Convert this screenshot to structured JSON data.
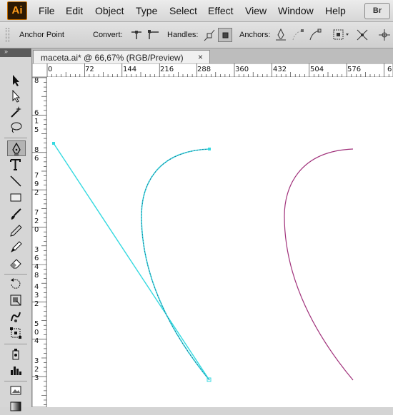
{
  "app": {
    "logo": "Ai",
    "menus": [
      "File",
      "Edit",
      "Object",
      "Type",
      "Select",
      "Effect",
      "View",
      "Window",
      "Help"
    ],
    "bridge_button": "Br"
  },
  "control_bar": {
    "tool_name": "Anchor Point",
    "convert_label": "Convert:",
    "handles_label": "Handles:",
    "anchors_label": "Anchors:"
  },
  "document": {
    "tab_title": "maceta.ai* @ 66,67% (RGB/Preview)",
    "close_glyph": "×",
    "zoom": "66,67%",
    "color_mode": "RGB/Preview"
  },
  "rulers": {
    "horizontal": [
      "0",
      "72",
      "144",
      "216",
      "288",
      "360",
      "432",
      "504",
      "576",
      "6"
    ],
    "vertical": [
      "8",
      "6",
      "1",
      "5",
      "8",
      "6",
      "7",
      "9",
      "2",
      "7",
      "2",
      "0",
      "3",
      "6",
      "4",
      "8",
      "4",
      "3",
      "2",
      "5",
      "0",
      "4",
      "3",
      "2",
      "3"
    ]
  },
  "colors": {
    "selected_path": "#35d9e0",
    "path": "#a0307a",
    "logo_bg": "#2d1a04",
    "logo_text": "#ff9c1a"
  },
  "tools": [
    "selection-icon",
    "direct-selection-icon",
    "magic-wand-icon",
    "lasso-icon",
    "pen-icon",
    "type-icon",
    "line-segment-icon",
    "rectangle-icon",
    "paintbrush-icon",
    "pencil-icon",
    "blob-brush-icon",
    "eraser-icon",
    "rotate-icon",
    "scale-icon",
    "warp-icon",
    "free-transform-icon",
    "symbol-sprayer-icon",
    "column-graph-icon",
    "artboard-icon",
    "gradient-icon"
  ]
}
